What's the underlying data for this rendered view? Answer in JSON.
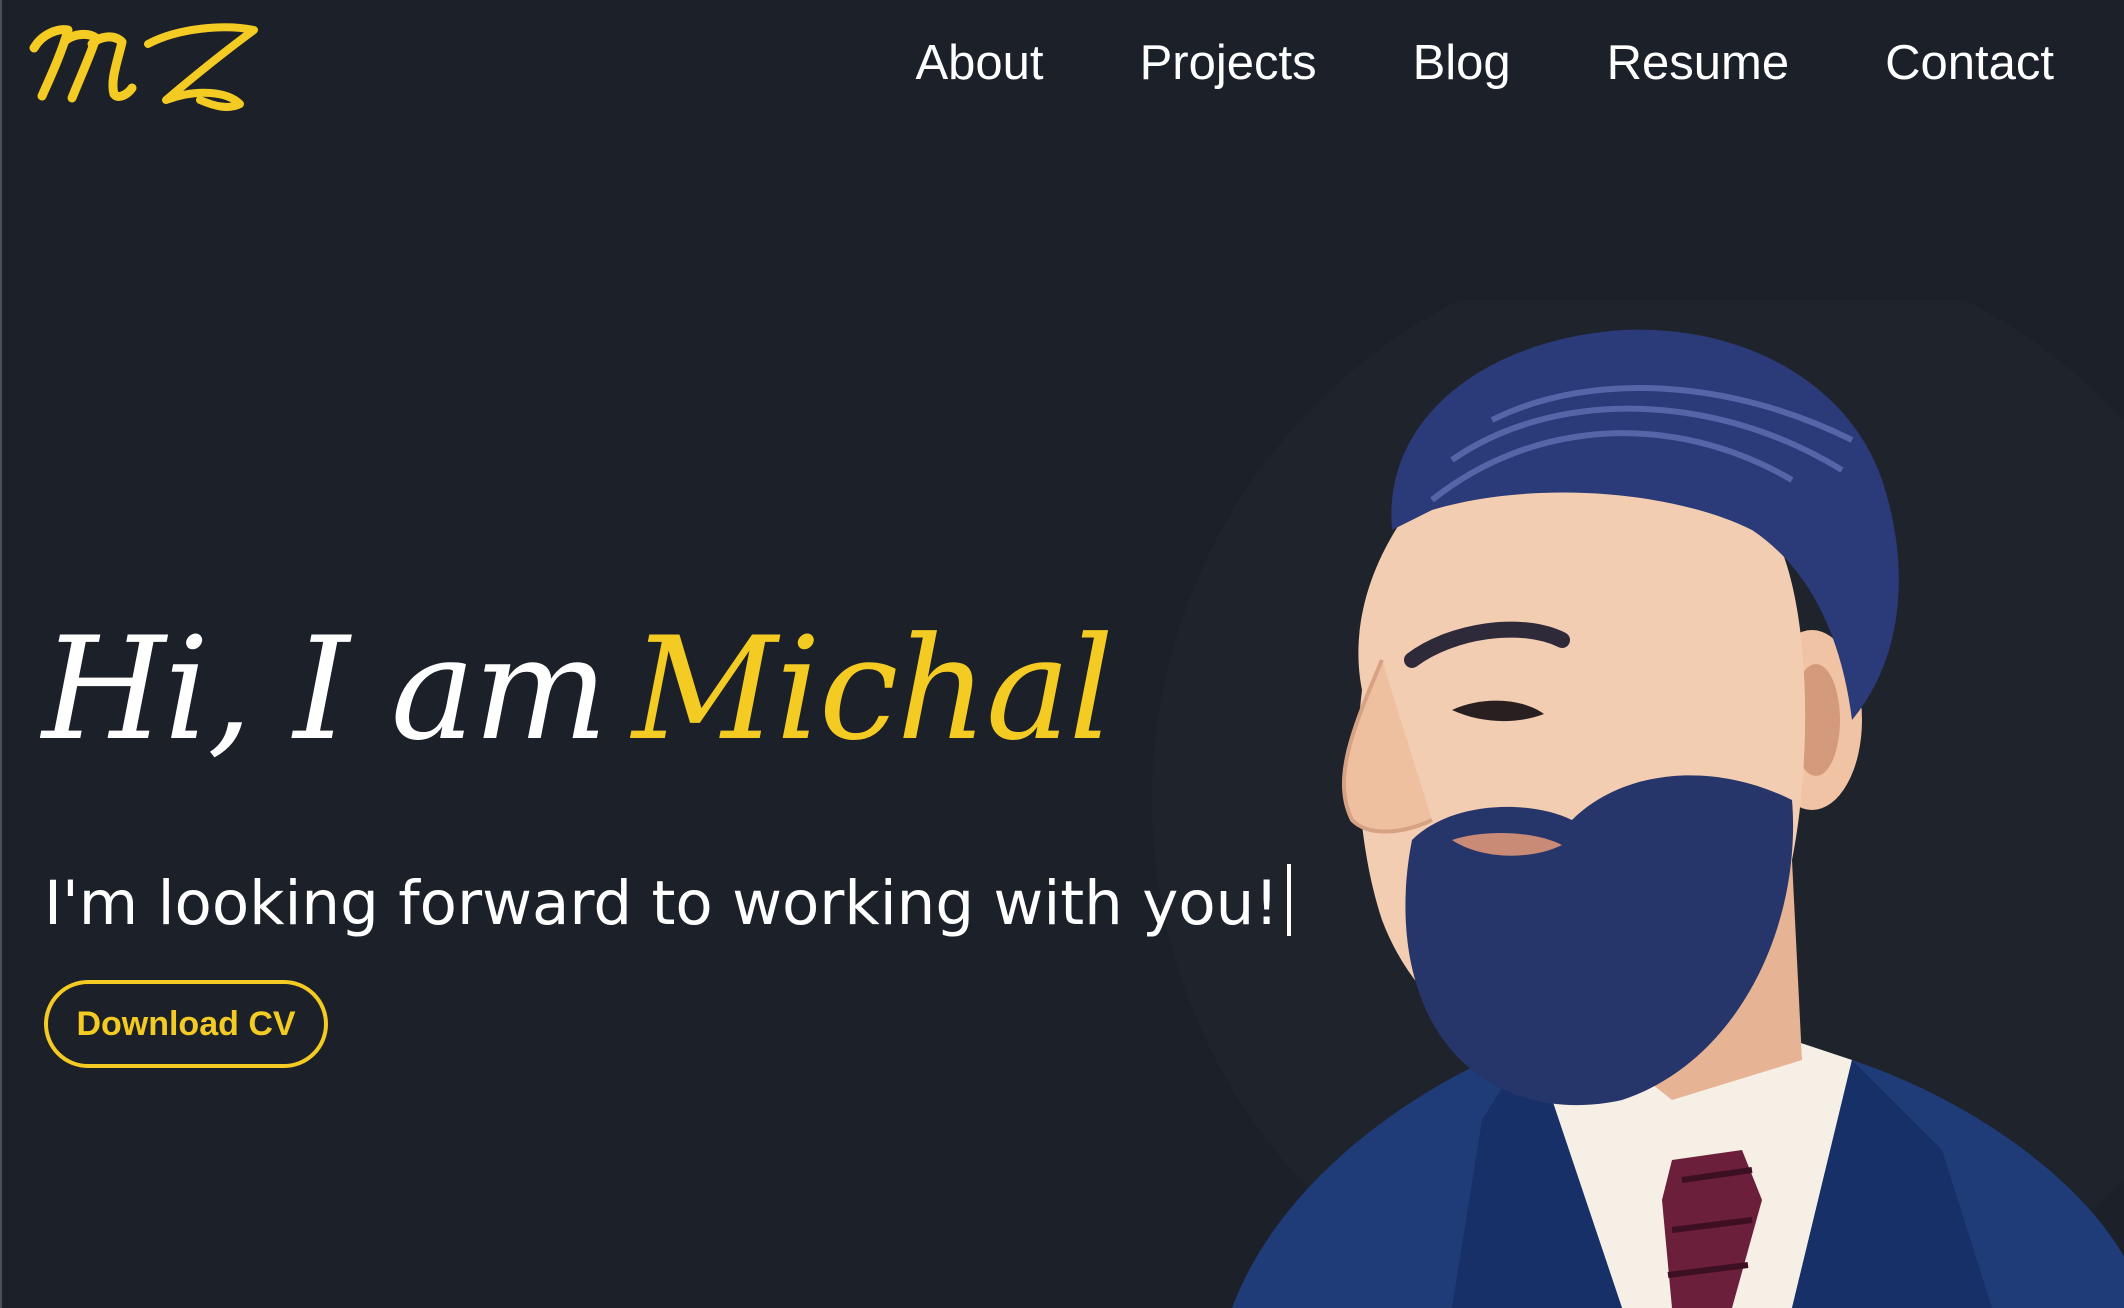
{
  "header": {
    "logo_text": "MZ",
    "nav": [
      "About",
      "Projects",
      "Blog",
      "Resume",
      "Contact"
    ]
  },
  "hero": {
    "greeting": "Hi, I am",
    "name": "Michal",
    "tagline": "I'm looking forward to working with you!",
    "download_label": "Download CV"
  },
  "colors": {
    "background": "#1c2028",
    "accent": "#f4cb23",
    "text": "#ffffff"
  },
  "icons": {
    "logo": "mz-monogram-logo",
    "portrait": "bearded-man-portrait-illustration"
  }
}
